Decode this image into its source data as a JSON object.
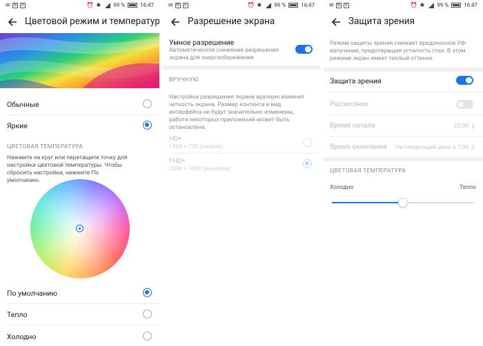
{
  "status_bar": {
    "battery": "99 %",
    "time": "16:47"
  },
  "screen1": {
    "title": "Цветовой режим и температура",
    "modes": [
      {
        "label": "Обычные",
        "selected": false
      },
      {
        "label": "Яркие",
        "selected": true
      }
    ],
    "section": "ЦВЕТОВАЯ ТЕМПЕРАТУРА",
    "hint": "Нажмите на круг или перетащите точку для настройки цветовой температуры. Чтобы сбросить настройки, нажмите По умолчанию.",
    "presets": [
      {
        "label": "По умолчанию",
        "selected": true
      },
      {
        "label": "Тепло",
        "selected": false
      },
      {
        "label": "Холодно",
        "selected": false
      }
    ]
  },
  "screen2": {
    "title": "Разрешение экрана",
    "smart": {
      "label": "Умное разрешение",
      "desc": "Автоматическое снижение разрешения экрана для энергосбережения",
      "on": true
    },
    "section": "ВРУЧНУЮ",
    "manual_desc": "Настройка разрешения экрана вручную изменит четкость экрана. Размер контента и вид интерфейса не будут значительно изменены, работа некоторых приложений может быть остановлена.",
    "options": [
      {
        "label": "HD+",
        "sub": "1560 × 720 (низкое)",
        "selected": false
      },
      {
        "label": "FHD+",
        "sub": "2340 × 1080 (высокое)",
        "selected": true
      }
    ]
  },
  "screen3": {
    "title": "Защита зрения",
    "desc": "Режим защиты зрения снижает вредоносное УФ-излучение, предотвращая усталость глаз. В этом режиме экран имеет теплый оттенок.",
    "eye_protection": {
      "label": "Защита зрения",
      "on": true
    },
    "schedule": {
      "label": "Расписание",
      "on": false
    },
    "start": {
      "label": "Время начала",
      "value": "22:00"
    },
    "end": {
      "label": "Время окончания",
      "value": "На следующий день в 7:00"
    },
    "section": "ЦВЕТОВАЯ ТЕМПЕРАТУРА",
    "temp": {
      "left": "Холодно",
      "right": "Тепло",
      "value": 0.5
    }
  },
  "colors": {
    "accent": "#1a73e8"
  }
}
